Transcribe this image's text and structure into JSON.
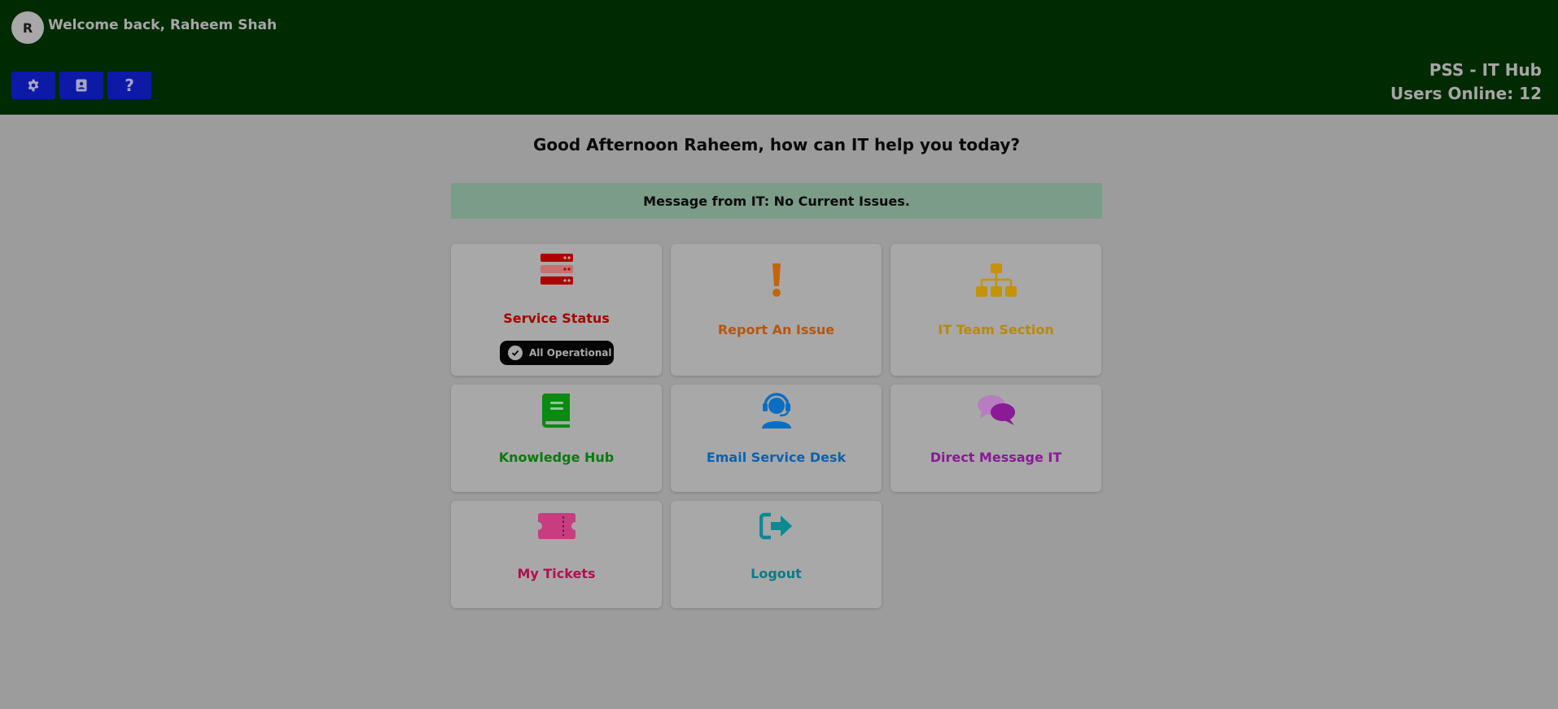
{
  "header": {
    "avatar_initial": "R",
    "welcome_text": "Welcome back, Raheem Shah",
    "toolbar": [
      {
        "name": "settings",
        "icon": "gear-icon"
      },
      {
        "name": "address-book",
        "icon": "address-book-icon"
      },
      {
        "name": "help",
        "icon": "question-icon",
        "glyph": "?"
      }
    ],
    "brand_title": "PSS - IT Hub",
    "users_online": "Users Online: 12"
  },
  "main": {
    "greeting": "Good Afternoon Raheem, how can IT help you today?",
    "notice": "Message from IT: No Current Issues.",
    "cards": [
      {
        "label": "Service Status",
        "icon": "server-icon",
        "color": "#a80000",
        "status": "All Operational"
      },
      {
        "label": "Report An Issue",
        "icon": "exclamation-icon",
        "color": "#b8560a"
      },
      {
        "label": "IT Team Section",
        "icon": "org-chart-icon",
        "color": "#b8890a"
      },
      {
        "label": "Knowledge Hub",
        "icon": "book-icon",
        "color": "#0a7a10"
      },
      {
        "label": "Email Service Desk",
        "icon": "headset-user-icon",
        "color": "#0a63b0"
      },
      {
        "label": "Direct Message IT",
        "icon": "chat-bubbles-icon",
        "color": "#8a1a95"
      },
      {
        "label": "My Tickets",
        "icon": "ticket-icon",
        "color": "#b01050"
      },
      {
        "label": "Logout",
        "icon": "logout-icon",
        "color": "#0a7a85"
      }
    ]
  }
}
